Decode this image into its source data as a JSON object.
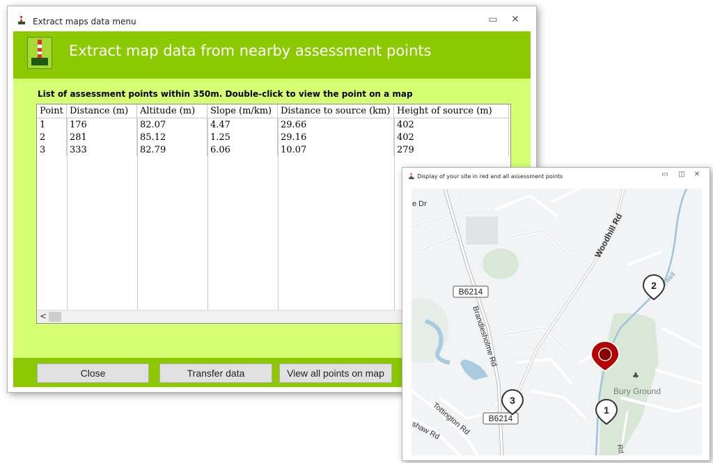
{
  "main_window": {
    "title": "Extract maps data menu",
    "banner_title": "Extract map data from nearby assessment points",
    "list_caption": "List of assessment points within 350m. Double-click to view the point on a map",
    "columns": [
      "Point",
      "Distance (m)",
      "Altitude (m)",
      "Slope (m/km)",
      "Distance to source (km)",
      "Height of source (m)"
    ],
    "rows": [
      [
        "1",
        "176",
        "82.07",
        "4.47",
        "29.66",
        "402"
      ],
      [
        "2",
        "281",
        "85.12",
        "1.25",
        "29.16",
        "402"
      ],
      [
        "3",
        "333",
        "82.79",
        "6.06",
        "10.07",
        "279"
      ]
    ],
    "buttons": {
      "close": "Close",
      "transfer": "Transfer data",
      "view_all": "View all points on map"
    },
    "minimize_glyph": "▭",
    "close_glyph": "✕"
  },
  "map_window": {
    "title": "Display of your site in red and all assessment points",
    "minimize_glyph": "▭",
    "restore_glyph": "◫",
    "close_glyph": "✕",
    "labels": {
      "road_b6214_a": "B6214",
      "road_b6214_b": "B6214",
      "woodhill": "Woodhill Rd",
      "brandlesholme": "Brandlesholme Rd",
      "tottington": "Tottington Rd",
      "river": "River Irwell",
      "park": "Bury Ground",
      "drive": "e Dr",
      "shaw": "shaw Rd",
      "rd_stub": "Rd"
    },
    "markers": [
      {
        "label": "1"
      },
      {
        "label": "2"
      },
      {
        "label": "3"
      }
    ],
    "colors": {
      "site_marker": "#b40000",
      "assessment_marker": "#333333",
      "river": "#9ec4db",
      "park": "#d9e8d6"
    }
  },
  "colors": {
    "banner": "#8cc900",
    "content_bg": "#d6ff73"
  }
}
